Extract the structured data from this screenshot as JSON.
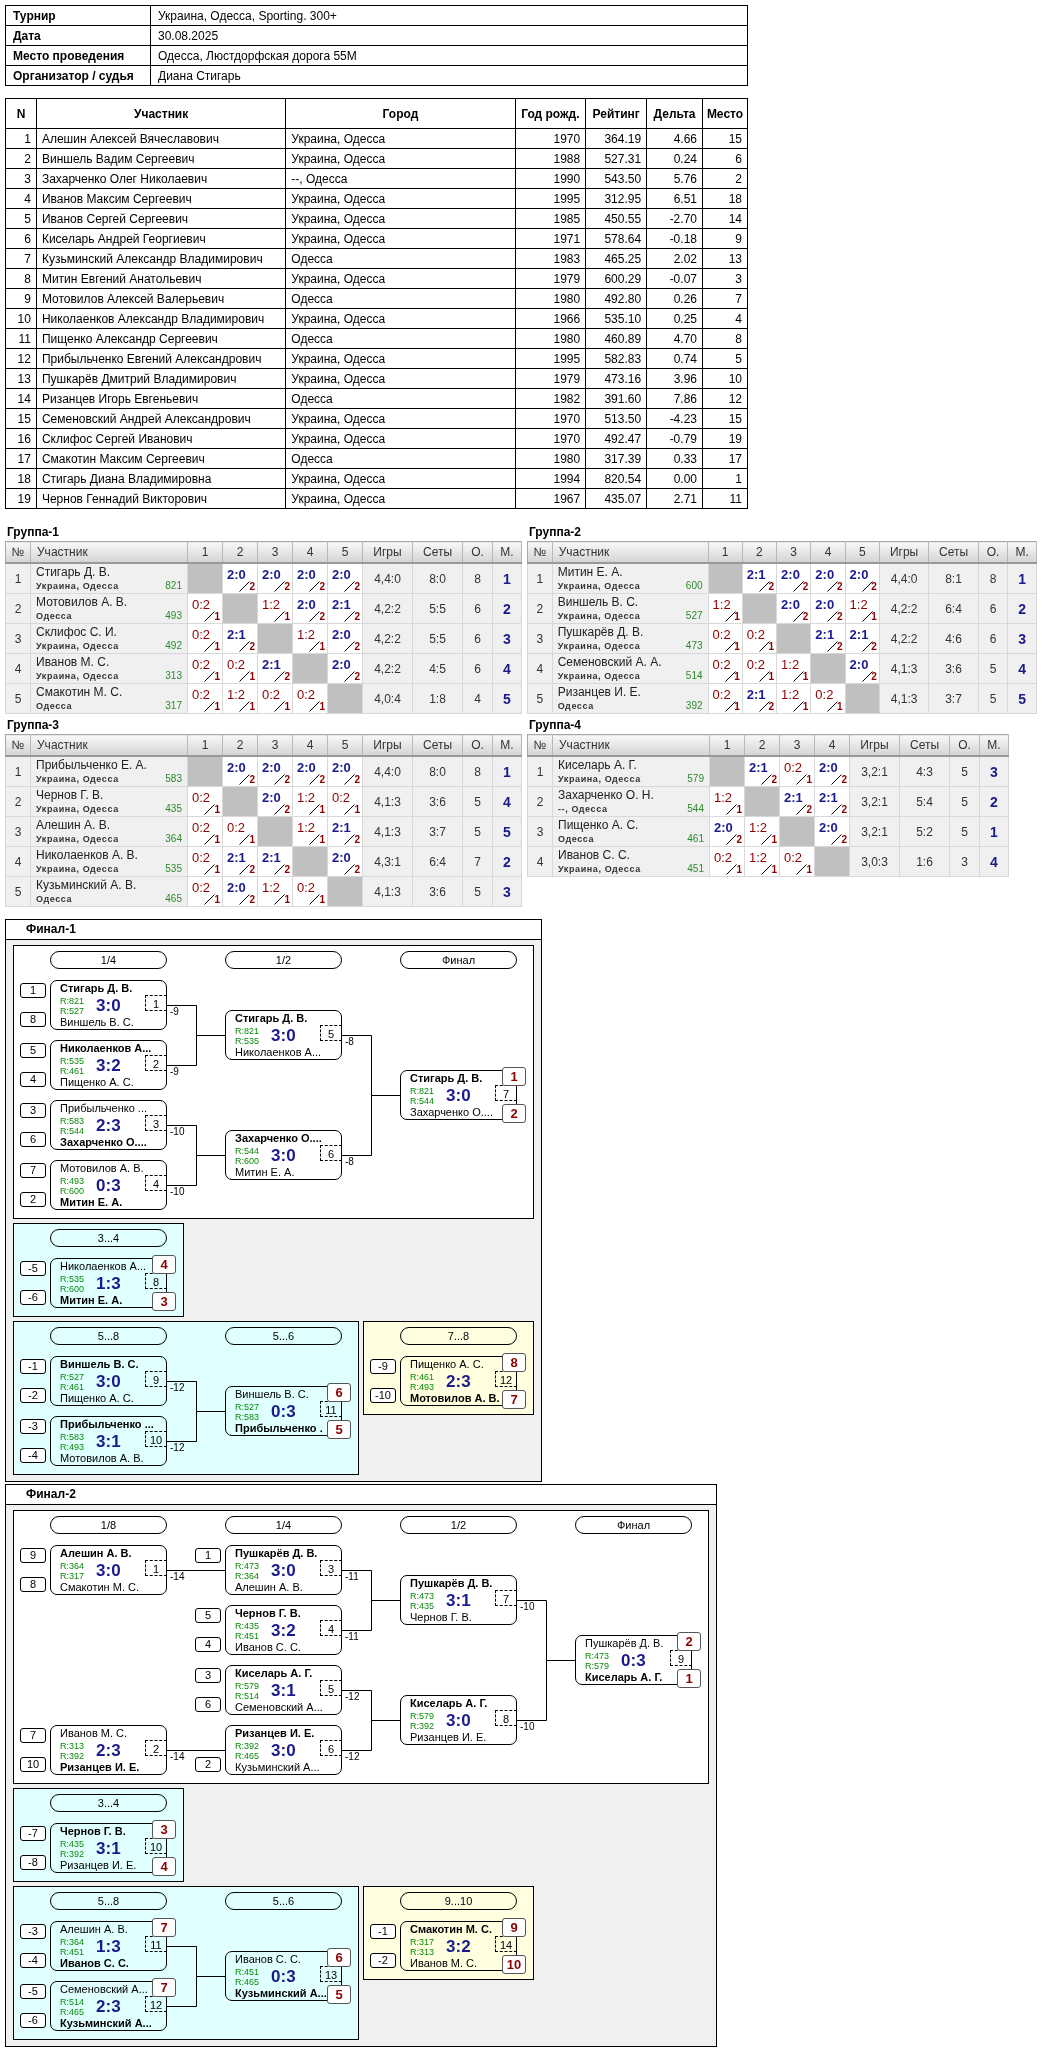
{
  "info": [
    {
      "label": "Турнир",
      "value": "Украина, Одесса, Sporting. 300+"
    },
    {
      "label": "Дата",
      "value": "30.08.2025"
    },
    {
      "label": "Место проведения",
      "value": "Одесса, Люстдорфская дорога 55М"
    },
    {
      "label": "Организатор / судья",
      "value": "Диана Стигарь"
    }
  ],
  "participants": {
    "columns": [
      "N",
      "Участник",
      "Город",
      "Год рожд.",
      "Рейтинг",
      "Дельта",
      "Место"
    ],
    "rows": [
      [
        "1",
        "Алешин Алексей Вячеславович",
        "Украина, Одесса",
        "1970",
        "364.19",
        "4.66",
        "15"
      ],
      [
        "2",
        "Виншель Вадим Сергеевич",
        "Украина, Одесса",
        "1988",
        "527.31",
        "0.24",
        "6"
      ],
      [
        "3",
        "Захарченко Олег Николаевич",
        "--, Одесса",
        "1990",
        "543.50",
        "5.76",
        "2"
      ],
      [
        "4",
        "Иванов Максим Сергеевич",
        "Украина, Одесса",
        "1995",
        "312.95",
        "6.51",
        "18"
      ],
      [
        "5",
        "Иванов Сергей Сергеевич",
        "Украина, Одесса",
        "1985",
        "450.55",
        "-2.70",
        "14"
      ],
      [
        "6",
        "Киселарь Андрей Георгиевич",
        "Украина, Одесса",
        "1971",
        "578.64",
        "-0.18",
        "9"
      ],
      [
        "7",
        "Кузьминский Александр Владимирович",
        "Одесса",
        "1983",
        "465.25",
        "2.02",
        "13"
      ],
      [
        "8",
        "Митин Евгений Анатольевич",
        "Украина, Одесса",
        "1979",
        "600.29",
        "-0.07",
        "3"
      ],
      [
        "9",
        "Мотовилов Алексей Валерьевич",
        "Одесса",
        "1980",
        "492.80",
        "0.26",
        "7"
      ],
      [
        "10",
        "Николаенков Александр Владимирович",
        "Украина, Одесса",
        "1966",
        "535.10",
        "0.25",
        "4"
      ],
      [
        "11",
        "Пищенко Александр Сергеевич",
        "Одесса",
        "1980",
        "460.89",
        "4.70",
        "8"
      ],
      [
        "12",
        "Прибыльченко Евгений Александрович",
        "Украина, Одесса",
        "1995",
        "582.83",
        "0.74",
        "5"
      ],
      [
        "13",
        "Пушкарёв Дмитрий Владимирович",
        "Украина, Одесса",
        "1979",
        "473.16",
        "3.96",
        "10"
      ],
      [
        "14",
        "Ризанцев Игорь Евгеньевич",
        "Одесса",
        "1982",
        "391.60",
        "7.86",
        "12"
      ],
      [
        "15",
        "Семеновский Андрей Александрович",
        "Украина, Одесса",
        "1970",
        "513.50",
        "-4.23",
        "15"
      ],
      [
        "16",
        "Склифос Сергей Иванович",
        "Украина, Одесса",
        "1970",
        "492.47",
        "-0.79",
        "19"
      ],
      [
        "17",
        "Смакотин Максим Сергеевич",
        "Одесса",
        "1980",
        "317.39",
        "0.33",
        "17"
      ],
      [
        "18",
        "Стигарь Диана Владимировна",
        "Украина, Одесса",
        "1994",
        "820.54",
        "0.00",
        "1"
      ],
      [
        "19",
        "Чернов Геннадий Викторович",
        "Украина, Одесса",
        "1967",
        "435.07",
        "2.71",
        "11"
      ]
    ]
  },
  "groups": [
    {
      "title": "Группа-1",
      "columns": [
        "№",
        "Участник",
        "1",
        "2",
        "3",
        "4",
        "5",
        "Игры",
        "Сеты",
        "О.",
        "М."
      ],
      "rows": [
        {
          "n": "1",
          "name": "Стигарь Д. В.",
          "city": "Украина, Одесса",
          "rating": "821",
          "results": [
            {
              "kind": "self"
            },
            {
              "kind": "played",
              "score": "2:0",
              "earned": "2",
              "win": true
            },
            {
              "kind": "played",
              "score": "2:0",
              "earned": "2",
              "win": true
            },
            {
              "kind": "played",
              "score": "2:0",
              "earned": "2",
              "win": true
            },
            {
              "kind": "played",
              "score": "2:0",
              "earned": "2",
              "win": true
            }
          ],
          "games": "4,4:0",
          "sets": "8:0",
          "points": "8",
          "place": "1"
        },
        {
          "n": "2",
          "name": "Мотовилов А. В.",
          "city": "Одесса",
          "rating": "493",
          "results": [
            {
              "kind": "played",
              "score": "0:2",
              "earned": "1",
              "win": false
            },
            {
              "kind": "self"
            },
            {
              "kind": "played",
              "score": "1:2",
              "earned": "1",
              "win": false
            },
            {
              "kind": "played",
              "score": "2:0",
              "earned": "2",
              "win": true
            },
            {
              "kind": "played",
              "score": "2:1",
              "earned": "2",
              "win": true
            }
          ],
          "games": "4,2:2",
          "sets": "5:5",
          "points": "6",
          "place": "2"
        },
        {
          "n": "3",
          "name": "Склифос С. И.",
          "city": "Украина, Одесса",
          "rating": "492",
          "results": [
            {
              "kind": "played",
              "score": "0:2",
              "earned": "1",
              "win": false
            },
            {
              "kind": "played",
              "score": "2:1",
              "earned": "2",
              "win": true
            },
            {
              "kind": "self"
            },
            {
              "kind": "played",
              "score": "1:2",
              "earned": "1",
              "win": false
            },
            {
              "kind": "played",
              "score": "2:0",
              "earned": "2",
              "win": true
            }
          ],
          "games": "4,2:2",
          "sets": "5:5",
          "points": "6",
          "place": "3"
        },
        {
          "n": "4",
          "name": "Иванов М. С.",
          "city": "Украина, Одесса",
          "rating": "313",
          "results": [
            {
              "kind": "played",
              "score": "0:2",
              "earned": "1",
              "win": false
            },
            {
              "kind": "played",
              "score": "0:2",
              "earned": "1",
              "win": false
            },
            {
              "kind": "played",
              "score": "2:1",
              "earned": "2",
              "win": true
            },
            {
              "kind": "self"
            },
            {
              "kind": "played",
              "score": "2:0",
              "earned": "2",
              "win": true
            }
          ],
          "games": "4,2:2",
          "sets": "4:5",
          "points": "6",
          "place": "4"
        },
        {
          "n": "5",
          "name": "Смакотин М. С.",
          "city": "Одесса",
          "rating": "317",
          "results": [
            {
              "kind": "played",
              "score": "0:2",
              "earned": "1",
              "win": false
            },
            {
              "kind": "played",
              "score": "1:2",
              "earned": "1",
              "win": false
            },
            {
              "kind": "played",
              "score": "0:2",
              "earned": "1",
              "win": false
            },
            {
              "kind": "played",
              "score": "0:2",
              "earned": "1",
              "win": false
            },
            {
              "kind": "self"
            }
          ],
          "games": "4,0:4",
          "sets": "1:8",
          "points": "4",
          "place": "5"
        }
      ]
    },
    {
      "title": "Группа-2",
      "columns": [
        "№",
        "Участник",
        "1",
        "2",
        "3",
        "4",
        "5",
        "Игры",
        "Сеты",
        "О.",
        "М."
      ],
      "rows": [
        {
          "n": "1",
          "name": "Митин Е. А.",
          "city": "Украина, Одесса",
          "rating": "600",
          "results": [
            {
              "kind": "self"
            },
            {
              "kind": "played",
              "score": "2:1",
              "earned": "2",
              "win": true
            },
            {
              "kind": "played",
              "score": "2:0",
              "earned": "2",
              "win": true
            },
            {
              "kind": "played",
              "score": "2:0",
              "earned": "2",
              "win": true
            },
            {
              "kind": "played",
              "score": "2:0",
              "earned": "2",
              "win": true
            }
          ],
          "games": "4,4:0",
          "sets": "8:1",
          "points": "8",
          "place": "1"
        },
        {
          "n": "2",
          "name": "Виншель В. С.",
          "city": "Украина, Одесса",
          "rating": "527",
          "results": [
            {
              "kind": "played",
              "score": "1:2",
              "earned": "1",
              "win": false
            },
            {
              "kind": "self"
            },
            {
              "kind": "played",
              "score": "2:0",
              "earned": "2",
              "win": true
            },
            {
              "kind": "played",
              "score": "2:0",
              "earned": "2",
              "win": true
            },
            {
              "kind": "played",
              "score": "1:2",
              "earned": "1",
              "win": false
            }
          ],
          "games": "4,2:2",
          "sets": "6:4",
          "points": "6",
          "place": "2"
        },
        {
          "n": "3",
          "name": "Пушкарёв Д. В.",
          "city": "Украина, Одесса",
          "rating": "473",
          "results": [
            {
              "kind": "played",
              "score": "0:2",
              "earned": "1",
              "win": false
            },
            {
              "kind": "played",
              "score": "0:2",
              "earned": "1",
              "win": false
            },
            {
              "kind": "self"
            },
            {
              "kind": "played",
              "score": "2:1",
              "earned": "2",
              "win": true
            },
            {
              "kind": "played",
              "score": "2:1",
              "earned": "2",
              "win": true
            }
          ],
          "games": "4,2:2",
          "sets": "4:6",
          "points": "6",
          "place": "3"
        },
        {
          "n": "4",
          "name": "Семеновский А. А.",
          "city": "Украина, Одесса",
          "rating": "514",
          "results": [
            {
              "kind": "played",
              "score": "0:2",
              "earned": "1",
              "win": false
            },
            {
              "kind": "played",
              "score": "0:2",
              "earned": "1",
              "win": false
            },
            {
              "kind": "played",
              "score": "1:2",
              "earned": "1",
              "win": false
            },
            {
              "kind": "self"
            },
            {
              "kind": "played",
              "score": "2:0",
              "earned": "2",
              "win": true
            }
          ],
          "games": "4,1:3",
          "sets": "3:6",
          "points": "5",
          "place": "4"
        },
        {
          "n": "5",
          "name": "Ризанцев И. Е.",
          "city": "Одесса",
          "rating": "392",
          "results": [
            {
              "kind": "played",
              "score": "0:2",
              "earned": "1",
              "win": false
            },
            {
              "kind": "played",
              "score": "2:1",
              "earned": "2",
              "win": true
            },
            {
              "kind": "played",
              "score": "1:2",
              "earned": "1",
              "win": false
            },
            {
              "kind": "played",
              "score": "0:2",
              "earned": "1",
              "win": false
            },
            {
              "kind": "self"
            }
          ],
          "games": "4,1:3",
          "sets": "3:7",
          "points": "5",
          "place": "5"
        }
      ]
    },
    {
      "title": "Группа-3",
      "columns": [
        "№",
        "Участник",
        "1",
        "2",
        "3",
        "4",
        "5",
        "Игры",
        "Сеты",
        "О.",
        "М."
      ],
      "rows": [
        {
          "n": "1",
          "name": "Прибыльченко Е. А.",
          "city": "Украина, Одесса",
          "rating": "583",
          "results": [
            {
              "kind": "self"
            },
            {
              "kind": "played",
              "score": "2:0",
              "earned": "2",
              "win": true
            },
            {
              "kind": "played",
              "score": "2:0",
              "earned": "2",
              "win": true
            },
            {
              "kind": "played",
              "score": "2:0",
              "earned": "2",
              "win": true
            },
            {
              "kind": "played",
              "score": "2:0",
              "earned": "2",
              "win": true
            }
          ],
          "games": "4,4:0",
          "sets": "8:0",
          "points": "8",
          "place": "1"
        },
        {
          "n": "2",
          "name": "Чернов Г. В.",
          "city": "Украина, Одесса",
          "rating": "435",
          "results": [
            {
              "kind": "played",
              "score": "0:2",
              "earned": "1",
              "win": false
            },
            {
              "kind": "self"
            },
            {
              "kind": "played",
              "score": "2:0",
              "earned": "2",
              "win": true
            },
            {
              "kind": "played",
              "score": "1:2",
              "earned": "1",
              "win": false
            },
            {
              "kind": "played",
              "score": "0:2",
              "earned": "1",
              "win": false
            }
          ],
          "games": "4,1:3",
          "sets": "3:6",
          "points": "5",
          "place": "4"
        },
        {
          "n": "3",
          "name": "Алешин А. В.",
          "city": "Украина, Одесса",
          "rating": "364",
          "results": [
            {
              "kind": "played",
              "score": "0:2",
              "earned": "1",
              "win": false
            },
            {
              "kind": "played",
              "score": "0:2",
              "earned": "1",
              "win": false
            },
            {
              "kind": "self"
            },
            {
              "kind": "played",
              "score": "1:2",
              "earned": "1",
              "win": false
            },
            {
              "kind": "played",
              "score": "2:1",
              "earned": "2",
              "win": true
            }
          ],
          "games": "4,1:3",
          "sets": "3:7",
          "points": "5",
          "place": "5"
        },
        {
          "n": "4",
          "name": "Николаенков А. В.",
          "city": "Украина, Одесса",
          "rating": "535",
          "results": [
            {
              "kind": "played",
              "score": "0:2",
              "earned": "1",
              "win": false
            },
            {
              "kind": "played",
              "score": "2:1",
              "earned": "2",
              "win": true
            },
            {
              "kind": "played",
              "score": "2:1",
              "earned": "2",
              "win": true
            },
            {
              "kind": "self"
            },
            {
              "kind": "played",
              "score": "2:0",
              "earned": "2",
              "win": true
            }
          ],
          "games": "4,3:1",
          "sets": "6:4",
          "points": "7",
          "place": "2"
        },
        {
          "n": "5",
          "name": "Кузьминский А. В.",
          "city": "Одесса",
          "rating": "465",
          "results": [
            {
              "kind": "played",
              "score": "0:2",
              "earned": "1",
              "win": false
            },
            {
              "kind": "played",
              "score": "2:0",
              "earned": "2",
              "win": true
            },
            {
              "kind": "played",
              "score": "1:2",
              "earned": "1",
              "win": false
            },
            {
              "kind": "played",
              "score": "0:2",
              "earned": "1",
              "win": false
            },
            {
              "kind": "self"
            }
          ],
          "games": "4,1:3",
          "sets": "3:6",
          "points": "5",
          "place": "3"
        }
      ]
    },
    {
      "title": "Группа-4",
      "columns": [
        "№",
        "Участник",
        "1",
        "2",
        "3",
        "4",
        "Игры",
        "Сеты",
        "О.",
        "М."
      ],
      "rows": [
        {
          "n": "1",
          "name": "Киселарь А. Г.",
          "city": "Украина, Одесса",
          "rating": "579",
          "results": [
            {
              "kind": "self"
            },
            {
              "kind": "played",
              "score": "2:1",
              "earned": "2",
              "win": true
            },
            {
              "kind": "played",
              "score": "0:2",
              "earned": "1",
              "win": false
            },
            {
              "kind": "played",
              "score": "2:0",
              "earned": "2",
              "win": true
            }
          ],
          "games": "3,2:1",
          "sets": "4:3",
          "points": "5",
          "place": "3"
        },
        {
          "n": "2",
          "name": "Захарченко О. Н.",
          "city": "--, Одесса",
          "rating": "544",
          "results": [
            {
              "kind": "played",
              "score": "1:2",
              "earned": "1",
              "win": false
            },
            {
              "kind": "self"
            },
            {
              "kind": "played",
              "score": "2:1",
              "earned": "2",
              "win": true
            },
            {
              "kind": "played",
              "score": "2:1",
              "earned": "2",
              "win": true
            }
          ],
          "games": "3,2:1",
          "sets": "5:4",
          "points": "5",
          "place": "2"
        },
        {
          "n": "3",
          "name": "Пищенко А. С.",
          "city": "Одесса",
          "rating": "461",
          "results": [
            {
              "kind": "played",
              "score": "2:0",
              "earned": "2",
              "win": true
            },
            {
              "kind": "played",
              "score": "1:2",
              "earned": "1",
              "win": false
            },
            {
              "kind": "self"
            },
            {
              "kind": "played",
              "score": "2:0",
              "earned": "2",
              "win": true
            }
          ],
          "games": "3,2:1",
          "sets": "5:2",
          "points": "5",
          "place": "1"
        },
        {
          "n": "4",
          "name": "Иванов С. С.",
          "city": "Украина, Одесса",
          "rating": "451",
          "results": [
            {
              "kind": "played",
              "score": "0:2",
              "earned": "1",
              "win": false
            },
            {
              "kind": "played",
              "score": "1:2",
              "earned": "1",
              "win": false
            },
            {
              "kind": "played",
              "score": "0:2",
              "earned": "1",
              "win": false
            },
            {
              "kind": "self"
            }
          ],
          "games": "3,0:3",
          "sets": "1:6",
          "points": "3",
          "place": "4"
        }
      ]
    }
  ],
  "finals": [
    {
      "title": "Финал-1",
      "blocks": [
        {
          "color": "#ffffff",
          "rounds": [
            {
              "label": "1/4",
              "matches": [
                {
                  "number": "1",
                  "score": "3:0",
                  "next": "-9",
                  "players": [
                    {
                      "seed": "1",
                      "name": "Стигарь Д. В.",
                      "rating": "R:821",
                      "winner": true
                    },
                    {
                      "seed": "8",
                      "name": "Виншель В. С.",
                      "rating": "R:527",
                      "winner": false
                    }
                  ]
                },
                {
                  "number": "2",
                  "score": "3:2",
                  "next": "-9",
                  "players": [
                    {
                      "seed": "5",
                      "name": "Николаенков А...",
                      "rating": "R:535",
                      "winner": true
                    },
                    {
                      "seed": "4",
                      "name": "Пищенко А. С.",
                      "rating": "R:461",
                      "winner": false
                    }
                  ]
                },
                {
                  "number": "3",
                  "score": "2:3",
                  "next": "-10",
                  "players": [
                    {
                      "seed": "3",
                      "name": "Прибыльченко ...",
                      "rating": "R:583",
                      "winner": false
                    },
                    {
                      "seed": "6",
                      "name": "Захарченко О....",
                      "rating": "R:544",
                      "winner": true
                    }
                  ]
                },
                {
                  "number": "4",
                  "score": "0:3",
                  "next": "-10",
                  "players": [
                    {
                      "seed": "7",
                      "name": "Мотовилов А. В.",
                      "rating": "R:493",
                      "winner": false
                    },
                    {
                      "seed": "2",
                      "name": "Митин Е. А.",
                      "rating": "R:600",
                      "winner": true
                    }
                  ]
                }
              ]
            },
            {
              "label": "1/2",
              "matches": [
                {
                  "number": "5",
                  "score": "3:0",
                  "next": "-8",
                  "players": [
                    {
                      "name": "Стигарь Д. В.",
                      "rating": "R:821",
                      "winner": true
                    },
                    {
                      "name": "Николаенков А...",
                      "rating": "R:535",
                      "winner": false
                    }
                  ]
                },
                {
                  "number": "6",
                  "score": "3:0",
                  "next": "-8",
                  "players": [
                    {
                      "name": "Захарченко О....",
                      "rating": "R:544",
                      "winner": true
                    },
                    {
                      "name": "Митин Е. А.",
                      "rating": "R:600",
                      "winner": false
                    }
                  ]
                }
              ]
            },
            {
              "label": "Финал",
              "matches": [
                {
                  "number": "7",
                  "score": "3:0",
                  "players": [
                    {
                      "name": "Стигарь Д. В.",
                      "rating": "R:821",
                      "winner": true,
                      "place": "1"
                    },
                    {
                      "name": "Захарченко О....",
                      "rating": "R:544",
                      "winner": false,
                      "place": "2"
                    }
                  ]
                }
              ]
            }
          ]
        },
        {
          "color": "#e0ffff",
          "rounds": [
            {
              "label": "3...4",
              "matches": [
                {
                  "number": "8",
                  "score": "1:3",
                  "players": [
                    {
                      "seed": "-5",
                      "name": "Николаенков А...",
                      "rating": "R:535",
                      "winner": false,
                      "place": "4"
                    },
                    {
                      "seed": "-6",
                      "name": "Митин Е. А.",
                      "rating": "R:600",
                      "winner": true,
                      "place": "3"
                    }
                  ]
                }
              ]
            }
          ]
        },
        {
          "color": "#e0ffff",
          "rounds": [
            {
              "label": "5...8",
              "matches": [
                {
                  "number": "9",
                  "score": "3:0",
                  "next": "-12",
                  "players": [
                    {
                      "seed": "-1",
                      "name": "Виншель В. С.",
                      "rating": "R:527",
                      "winner": true
                    },
                    {
                      "seed": "-2",
                      "name": "Пищенко А. С.",
                      "rating": "R:461",
                      "winner": false
                    }
                  ]
                },
                {
                  "number": "10",
                  "score": "3:1",
                  "next": "-12",
                  "players": [
                    {
                      "seed": "-3",
                      "name": "Прибыльченко ...",
                      "rating": "R:583",
                      "winner": true
                    },
                    {
                      "seed": "-4",
                      "name": "Мотовилов А. В.",
                      "rating": "R:493",
                      "winner": false
                    }
                  ]
                }
              ]
            },
            {
              "label": "5...6",
              "matches": [
                {
                  "number": "11",
                  "score": "0:3",
                  "players": [
                    {
                      "name": "Виншель В. С.",
                      "rating": "R:527",
                      "winner": false,
                      "place": "6"
                    },
                    {
                      "name": "Прибыльченко .",
                      "rating": "R:583",
                      "winner": true,
                      "place": "5"
                    }
                  ]
                }
              ]
            }
          ]
        },
        {
          "color": "#ffffe0",
          "rounds": [
            {
              "label": "7...8",
              "matches": [
                {
                  "number": "12",
                  "score": "2:3",
                  "players": [
                    {
                      "seed": "-9",
                      "name": "Пищенко А. С.",
                      "rating": "R:461",
                      "winner": false,
                      "place": "8"
                    },
                    {
                      "seed": "-10",
                      "name": "Мотовилов А. В.",
                      "rating": "R:493",
                      "winner": true,
                      "place": "7"
                    }
                  ]
                }
              ]
            }
          ]
        }
      ]
    },
    {
      "title": "Финал-2",
      "blocks": [
        {
          "color": "#ffffff",
          "rounds": [
            {
              "label": "1/8",
              "matches": [
                {
                  "number": "1",
                  "score": "3:0",
                  "next": "-14",
                  "players": [
                    {
                      "seed": "9",
                      "name": "Алешин А. В.",
                      "rating": "R:364",
                      "winner": true
                    },
                    {
                      "seed": "8",
                      "name": "Смакотин М. С.",
                      "rating": "R:317",
                      "winner": false
                    }
                  ]
                },
                {
                  "number": "2",
                  "score": "2:3",
                  "next": "-14",
                  "players": [
                    {
                      "seed": "7",
                      "name": "Иванов М. С.",
                      "rating": "R:313",
                      "winner": false
                    },
                    {
                      "seed": "10",
                      "name": "Ризанцев И. Е.",
                      "rating": "R:392",
                      "winner": true
                    }
                  ]
                }
              ]
            },
            {
              "label": "1/4",
              "matches": [
                {
                  "number": "3",
                  "score": "3:0",
                  "next": "-11",
                  "players": [
                    {
                      "seed": "1",
                      "name": "Пушкарёв Д. В.",
                      "rating": "R:473",
                      "winner": true
                    },
                    {
                      "name": "Алешин А. В.",
                      "rating": "R:364",
                      "winner": false
                    }
                  ]
                },
                {
                  "number": "4",
                  "score": "3:2",
                  "next": "-11",
                  "players": [
                    {
                      "seed": "5",
                      "name": "Чернов Г. В.",
                      "rating": "R:435",
                      "winner": true
                    },
                    {
                      "seed": "4",
                      "name": "Иванов С. С.",
                      "rating": "R:451",
                      "winner": false
                    }
                  ]
                },
                {
                  "number": "5",
                  "score": "3:1",
                  "next": "-12",
                  "players": [
                    {
                      "seed": "3",
                      "name": "Киселарь А. Г.",
                      "rating": "R:579",
                      "winner": true
                    },
                    {
                      "seed": "6",
                      "name": "Семеновский А...",
                      "rating": "R:514",
                      "winner": false
                    }
                  ]
                },
                {
                  "number": "6",
                  "score": "3:0",
                  "next": "-12",
                  "players": [
                    {
                      "name": "Ризанцев И. Е.",
                      "rating": "R:392",
                      "winner": true
                    },
                    {
                      "seed": "2",
                      "name": "Кузьминский А...",
                      "rating": "R:465",
                      "winner": false
                    }
                  ]
                }
              ]
            },
            {
              "label": "1/2",
              "matches": [
                {
                  "number": "7",
                  "score": "3:1",
                  "next": "-10",
                  "players": [
                    {
                      "name": "Пушкарёв Д. В.",
                      "rating": "R:473",
                      "winner": true
                    },
                    {
                      "name": "Чернов Г. В.",
                      "rating": "R:435",
                      "winner": false
                    }
                  ]
                },
                {
                  "number": "8",
                  "score": "3:0",
                  "next": "-10",
                  "players": [
                    {
                      "name": "Киселарь А. Г.",
                      "rating": "R:579",
                      "winner": true
                    },
                    {
                      "name": "Ризанцев И. Е.",
                      "rating": "R:392",
                      "winner": false
                    }
                  ]
                }
              ]
            },
            {
              "label": "Финал",
              "matches": [
                {
                  "number": "9",
                  "score": "0:3",
                  "players": [
                    {
                      "name": "Пушкарёв Д. В.",
                      "rating": "R:473",
                      "winner": false,
                      "place": "2"
                    },
                    {
                      "name": "Киселарь А. Г.",
                      "rating": "R:579",
                      "winner": true,
                      "place": "1"
                    }
                  ]
                }
              ]
            }
          ]
        },
        {
          "color": "#e0ffff",
          "rounds": [
            {
              "label": "3...4",
              "matches": [
                {
                  "number": "10",
                  "score": "3:1",
                  "players": [
                    {
                      "seed": "-7",
                      "name": "Чернов Г. В.",
                      "rating": "R:435",
                      "winner": true,
                      "place": "3"
                    },
                    {
                      "seed": "-8",
                      "name": "Ризанцев И. Е.",
                      "rating": "R:392",
                      "winner": false,
                      "place": "4"
                    }
                  ]
                }
              ]
            }
          ]
        },
        {
          "color": "#e0ffff",
          "rounds": [
            {
              "label": "5...8",
              "matches": [
                {
                  "number": "11",
                  "score": "1:3",
                  "players": [
                    {
                      "seed": "-3",
                      "name": "Алешин А. В.",
                      "rating": "R:364",
                      "winner": false,
                      "place": "7"
                    },
                    {
                      "seed": "-4",
                      "name": "Иванов С. С.",
                      "rating": "R:451",
                      "winner": true
                    }
                  ]
                },
                {
                  "number": "12",
                  "score": "2:3",
                  "players": [
                    {
                      "seed": "-5",
                      "name": "Семеновский А...",
                      "rating": "R:514",
                      "winner": false,
                      "place": "7"
                    },
                    {
                      "seed": "-6",
                      "name": "Кузьминский А...",
                      "rating": "R:465",
                      "winner": true
                    }
                  ]
                }
              ]
            },
            {
              "label": "5...6",
              "matches": [
                {
                  "number": "13",
                  "score": "0:3",
                  "players": [
                    {
                      "name": "Иванов С. С.",
                      "rating": "R:451",
                      "winner": false,
                      "place": "6"
                    },
                    {
                      "name": "Кузьминский А...",
                      "rating": "R:465",
                      "winner": true,
                      "place": "5"
                    }
                  ]
                }
              ]
            }
          ]
        },
        {
          "color": "#ffffe0",
          "rounds": [
            {
              "label": "9...10",
              "matches": [
                {
                  "number": "14",
                  "score": "3:2",
                  "players": [
                    {
                      "seed": "-1",
                      "name": "Смакотин М. С.",
                      "rating": "R:317",
                      "winner": true,
                      "place": "9"
                    },
                    {
                      "seed": "-2",
                      "name": "Иванов М. С.",
                      "rating": "R:313",
                      "winner": false,
                      "place": "10"
                    }
                  ]
                }
              ]
            }
          ]
        }
      ]
    }
  ]
}
